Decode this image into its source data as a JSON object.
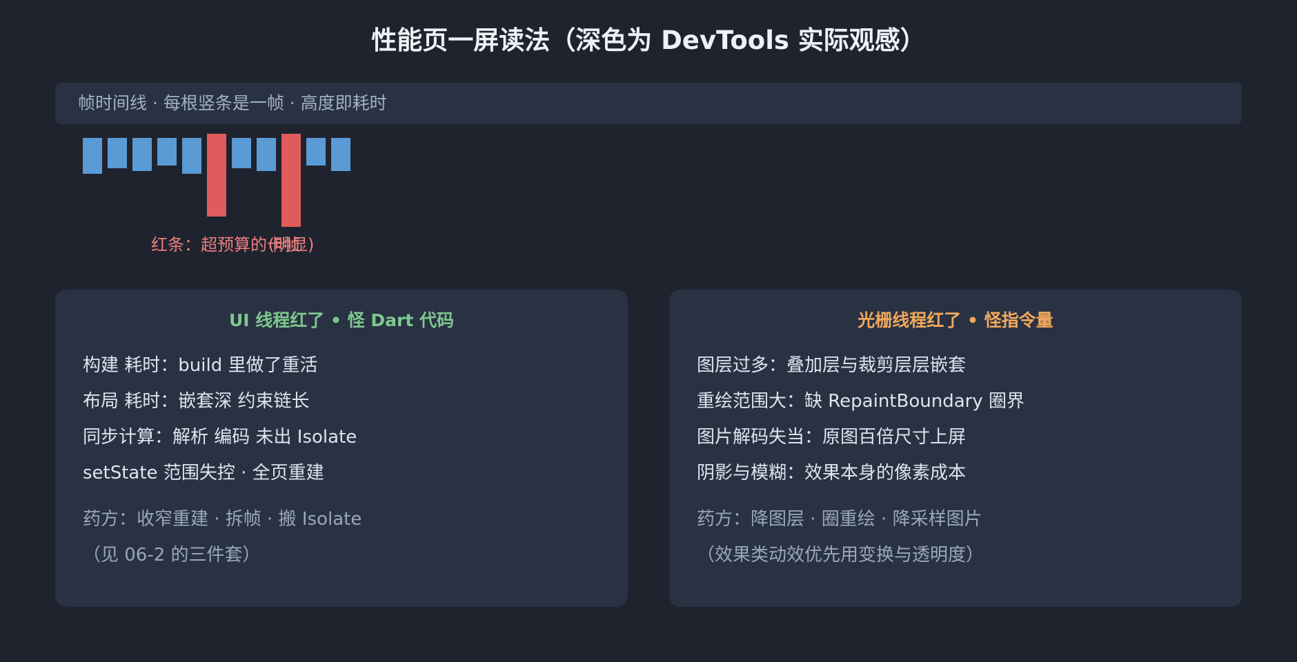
{
  "title": "性能页一屏读法（深色为 DevTools 实际观感）",
  "frame_banner": {
    "label": "帧时间线 · 每根竖条是一帧 · 高度即耗时"
  },
  "colors": {
    "normal_frame": "#5b9bd5",
    "jank_frame": "#e05c5c",
    "ui_title": "#7ec88f",
    "raster_title": "#f2a85c"
  },
  "chart_data": {
    "type": "bar",
    "categories": [],
    "series": [
      {
        "values": [
          52,
          44,
          48,
          40,
          52,
          120,
          44,
          48,
          135,
          40,
          48
        ],
        "jank": [
          false,
          false,
          false,
          false,
          false,
          true,
          false,
          false,
          true,
          false,
          false
        ]
      }
    ],
    "annotations": [
      {
        "text": "红条：超预算的卡帧",
        "frame_index": 5
      },
      {
        "text": "(明显)",
        "frame_index": 8
      }
    ],
    "xlabel": "",
    "ylabel": "",
    "grid": false
  },
  "panels": {
    "ui_thread": {
      "title": "UI 线程红了 • 怪 Dart 代码",
      "items": [
        "构建 耗时：build 里做了重活",
        "布局 耗时：嵌套深 约束链长",
        "同步计算：解析 编码 未出 Isolate",
        "setState 范围失控 · 全页重建"
      ],
      "remedy": "药方：收窄重建 · 拆帧 · 搬 Isolate",
      "remedy_note": "（见 06-2 的三件套）"
    },
    "raster_thread": {
      "title": "光栅线程红了 • 怪指令量",
      "items": [
        "图层过多：叠加层与裁剪层层嵌套",
        "重绘范围大：缺 RepaintBoundary 圈界",
        "图片解码失当：原图百倍尺寸上屏",
        "阴影与模糊：效果本身的像素成本"
      ],
      "remedy": "药方：降图层 · 圈重绘 · 降采样图片",
      "remedy_note": "（效果类动效优先用变换与透明度）"
    }
  }
}
